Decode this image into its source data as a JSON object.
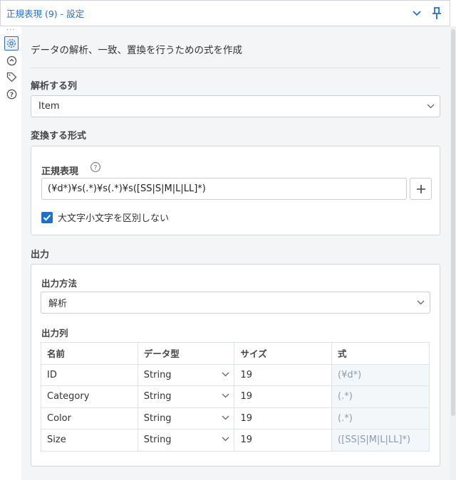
{
  "header": {
    "title": "正規表現 (9) - 設定"
  },
  "rail": {
    "items": [
      "settings-icon",
      "reset-icon",
      "tag-icon",
      "help-icon"
    ]
  },
  "description": "データの解析、一致、置換を行うための式を作成",
  "parse_column": {
    "label": "解析する列",
    "value": "Item"
  },
  "format": {
    "label": "変換する形式",
    "regex_label": "正規表現",
    "regex_value": "(¥d*)¥s(.*)¥s(.*)¥s([SS|S|M|L|LL]*)",
    "case_insensitive_label": "大文字小文字を区別しない",
    "case_insensitive": true
  },
  "output": {
    "label": "出力",
    "method_label": "出力方法",
    "method_value": "解析",
    "columns_label": "出力列",
    "table": {
      "headers": [
        "名前",
        "データ型",
        "サイズ",
        "式"
      ],
      "rows": [
        {
          "name": "ID",
          "type": "String",
          "size": "19",
          "expr": "(¥d*)"
        },
        {
          "name": "Category",
          "type": "String",
          "size": "19",
          "expr": "(.*)"
        },
        {
          "name": "Color",
          "type": "String",
          "size": "19",
          "expr": "(.*)"
        },
        {
          "name": "Size",
          "type": "String",
          "size": "19",
          "expr": "([SS|S|M|L|LL]*)"
        }
      ]
    }
  },
  "colors": {
    "accent": "#2a6ebd",
    "checkbox": "#1a73c9",
    "panel_bg": "#f3f5f7",
    "expr_text": "#8a9bb3"
  }
}
